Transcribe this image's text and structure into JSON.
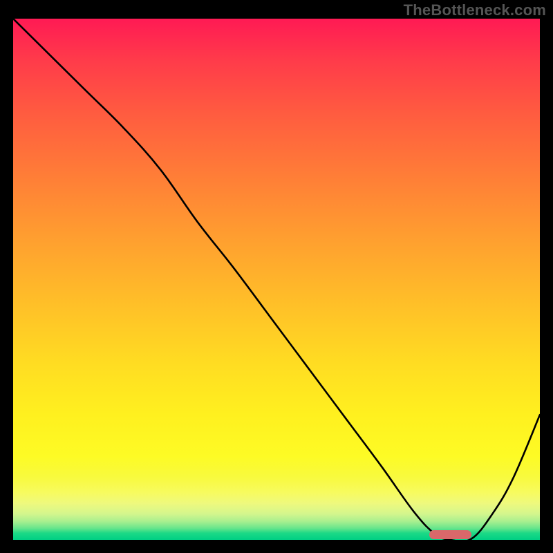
{
  "watermark": "TheBottleneck.com",
  "chart_data": {
    "type": "line",
    "title": "",
    "xlabel": "",
    "ylabel": "",
    "xlim": [
      0,
      100
    ],
    "ylim": [
      0,
      100
    ],
    "grid": false,
    "series": [
      {
        "name": "curve",
        "x": [
          0,
          7,
          14,
          21,
          28,
          35,
          42,
          49,
          56,
          63,
          70,
          76,
          80,
          83,
          87,
          91,
          95,
          100
        ],
        "y": [
          100,
          93,
          86,
          79,
          71,
          61,
          52,
          42.5,
          33,
          23.5,
          14,
          5.5,
          1.2,
          0,
          0.2,
          5,
          12,
          24
        ],
        "color": "#000000"
      }
    ],
    "marker": {
      "x_start": 79,
      "x_end": 87,
      "y": 0,
      "color": "#d9686a"
    },
    "colors": {
      "top": "#ff1a54",
      "mid": "#ffdc22",
      "bottom": "#00d084",
      "frame": "#000000"
    }
  }
}
